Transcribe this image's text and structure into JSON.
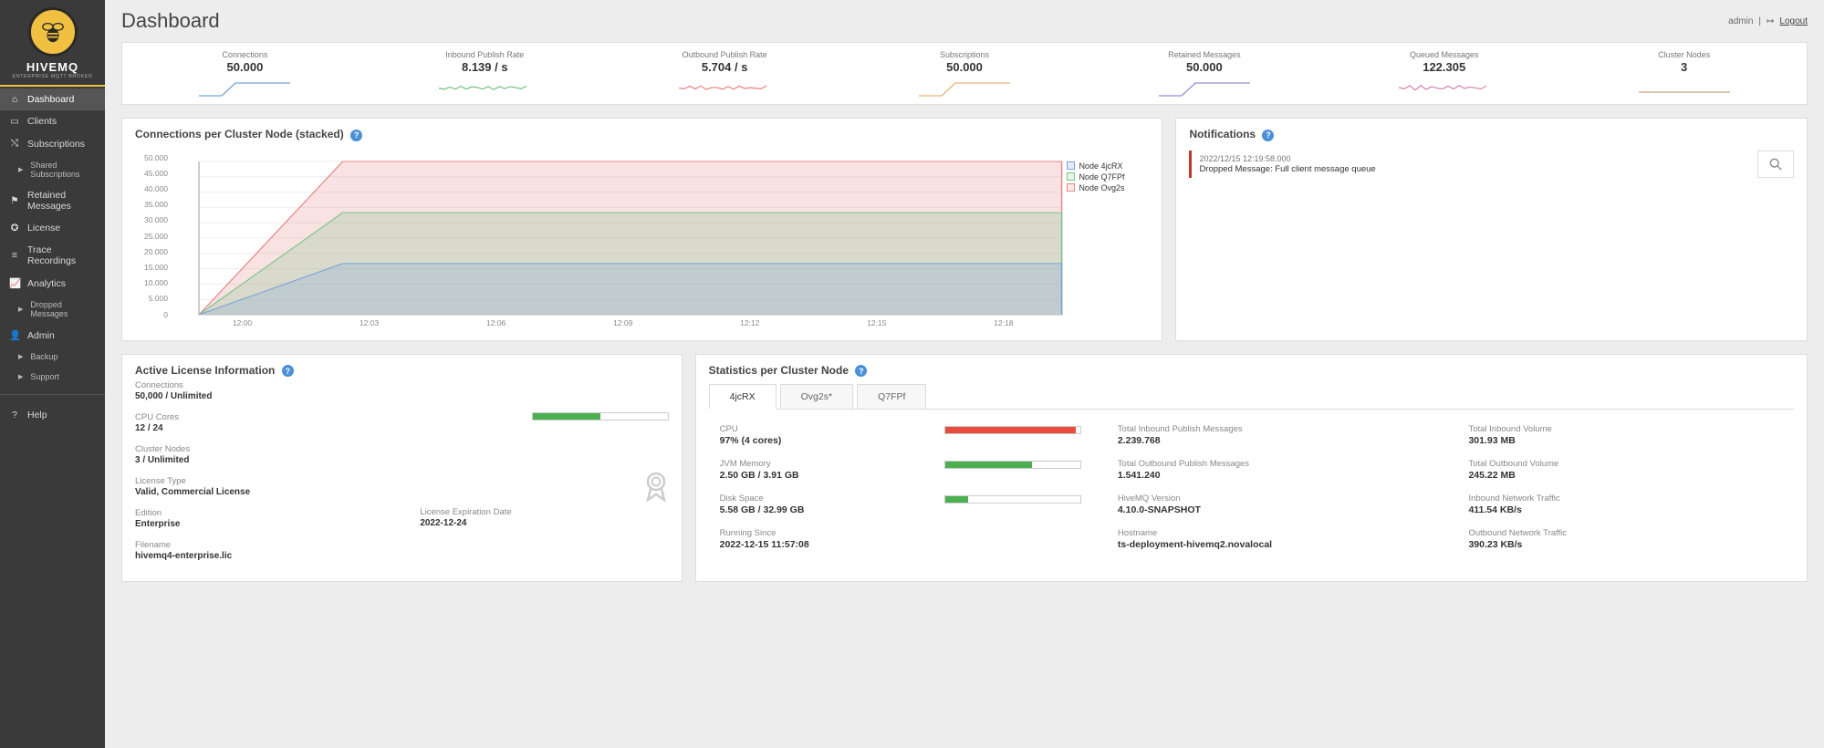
{
  "brand": {
    "title": "HIVEMQ",
    "sub": "ENTERPRISE MQTT BROKER"
  },
  "user": {
    "name": "admin",
    "logout": "Logout"
  },
  "page_title": "Dashboard",
  "nav": [
    {
      "label": "Dashboard"
    },
    {
      "label": "Clients"
    },
    {
      "label": "Subscriptions"
    },
    {
      "label": "Shared Subscriptions"
    },
    {
      "label": "Retained Messages"
    },
    {
      "label": "License"
    },
    {
      "label": "Trace Recordings"
    },
    {
      "label": "Analytics"
    },
    {
      "label": "Dropped Messages"
    },
    {
      "label": "Admin"
    },
    {
      "label": "Backup"
    },
    {
      "label": "Support"
    },
    {
      "label": "Help"
    }
  ],
  "kpis": [
    {
      "label": "Connections",
      "value": "50.000",
      "color": "#7aa3d8"
    },
    {
      "label": "Inbound Publish Rate",
      "value": "8.139 / s",
      "color": "#7cc58a"
    },
    {
      "label": "Outbound Publish Rate",
      "value": "5.704 / s",
      "color": "#e88a8a"
    },
    {
      "label": "Subscriptions",
      "value": "50.000",
      "color": "#e8b47a"
    },
    {
      "label": "Retained Messages",
      "value": "50.000",
      "color": "#9a8ed8"
    },
    {
      "label": "Queued Messages",
      "value": "122.305",
      "color": "#d88ab5"
    },
    {
      "label": "Cluster Nodes",
      "value": "3",
      "color": "#c2a97a"
    }
  ],
  "chart_data": {
    "type": "area",
    "title": "Connections per Cluster Node (stacked)",
    "x": [
      "12:00",
      "12:03",
      "12:06",
      "12:09",
      "12:12",
      "12:15",
      "12:18"
    ],
    "series": [
      {
        "name": "Node 4jcRX",
        "color": "#7aa3d8",
        "cum_values": [
          0,
          16700,
          16700,
          16700,
          16700,
          16700,
          16700
        ]
      },
      {
        "name": "Node Q7FPf",
        "color": "#7cc58a",
        "cum_values": [
          0,
          33300,
          33300,
          33300,
          33300,
          33300,
          33300
        ]
      },
      {
        "name": "Node Ovg2s",
        "color": "#e88a8a",
        "cum_values": [
          0,
          50000,
          50000,
          50000,
          50000,
          50000,
          50000
        ]
      }
    ],
    "ylim": [
      0,
      50000
    ],
    "yticks": [
      "0",
      "5.000",
      "10.000",
      "15.000",
      "20.000",
      "25.000",
      "30.000",
      "35.000",
      "40.000",
      "45.000",
      "50.000"
    ]
  },
  "notifications": {
    "title": "Notifications",
    "items": [
      {
        "ts": "2022/12/15 12:19:58.000",
        "msg": "Dropped Message: Full client message queue"
      }
    ]
  },
  "license": {
    "title": "Active License Information",
    "connections": {
      "label": "Connections",
      "value": "50,000 / Unlimited"
    },
    "cpu": {
      "label": "CPU Cores",
      "value": "12 / 24",
      "pct": 50
    },
    "nodes": {
      "label": "Cluster Nodes",
      "value": "3 / Unlimited"
    },
    "type": {
      "label": "License Type",
      "value": "Valid, Commercial License"
    },
    "edition": {
      "label": "Edition",
      "value": "Enterprise"
    },
    "filename": {
      "label": "Filename",
      "value": "hivemq4-enterprise.lic"
    },
    "expiry": {
      "label": "License Expiration Date",
      "value": "2022-12-24"
    }
  },
  "stats": {
    "title": "Statistics per Cluster Node",
    "tabs": [
      "4jcRX",
      "Ovg2s*",
      "Q7FPf"
    ],
    "active_tab": 0,
    "cpu": {
      "label": "CPU",
      "value": "97% (4 cores)",
      "pct": 97,
      "color": "#e74c3c"
    },
    "jvm": {
      "label": "JVM Memory",
      "value": "2.50 GB / 3.91 GB",
      "pct": 64,
      "color": "#4caf50"
    },
    "disk": {
      "label": "Disk Space",
      "value": "5.58 GB / 32.99 GB",
      "pct": 17,
      "color": "#4caf50"
    },
    "since": {
      "label": "Running Since",
      "value": "2022-12-15 11:57:08"
    },
    "inbound_msgs": {
      "label": "Total Inbound Publish Messages",
      "value": "2.239.768"
    },
    "outbound_msgs": {
      "label": "Total Outbound Publish Messages",
      "value": "1.541.240"
    },
    "version": {
      "label": "HiveMQ Version",
      "value": "4.10.0-SNAPSHOT"
    },
    "hostname": {
      "label": "Hostname",
      "value": "ts-deployment-hivemq2.novalocal"
    },
    "inbound_vol": {
      "label": "Total Inbound Volume",
      "value": "301.93 MB"
    },
    "outbound_vol": {
      "label": "Total Outbound Volume",
      "value": "245.22 MB"
    },
    "inbound_net": {
      "label": "Inbound Network Traffic",
      "value": "411.54 KB/s"
    },
    "outbound_net": {
      "label": "Outbound Network Traffic",
      "value": "390.23 KB/s"
    }
  }
}
